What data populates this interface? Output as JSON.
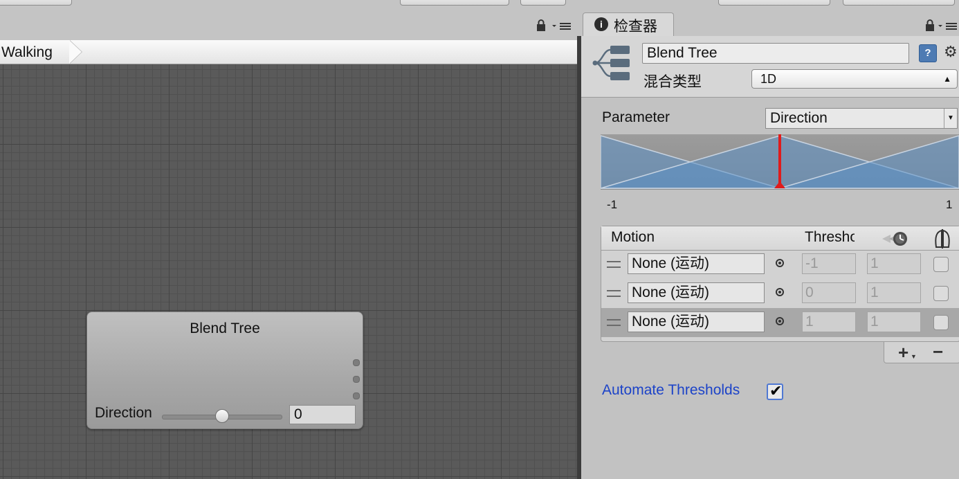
{
  "breadcrumb": {
    "label": "Walking"
  },
  "node": {
    "title": "Blend Tree",
    "param_name": "Direction",
    "param_value": "0",
    "slider_fraction": 0.5
  },
  "inspector": {
    "tab_label": "检查器",
    "tab_icon_glyph": "i",
    "object_name": "Blend Tree",
    "blend_type_label": "混合类型",
    "blend_type_value": "1D",
    "parameter_label": "Parameter",
    "parameter_value": "Direction",
    "graph": {
      "min_label": "-1",
      "max_label": "1",
      "min": -1,
      "max": 1,
      "current": 0,
      "thresholds": [
        -1,
        0,
        1
      ]
    },
    "list": {
      "header_motion": "Motion",
      "header_threshold": "Threshold",
      "rows": [
        {
          "motion": "None (运动)",
          "threshold": "-1",
          "speed": "1",
          "mirror": false,
          "selected": false
        },
        {
          "motion": "None (运动)",
          "threshold": "0",
          "speed": "1",
          "mirror": false,
          "selected": false
        },
        {
          "motion": "None (运动)",
          "threshold": "1",
          "speed": "1",
          "mirror": false,
          "selected": true
        }
      ]
    },
    "add_glyph": "+",
    "remove_glyph": "−",
    "automate_label": "Automate Thresholds",
    "automate_checked": true,
    "help_glyph": "?",
    "gear_glyph": "⚙"
  },
  "colors": {
    "accent": "#1c43c8",
    "graph_fill": "#5b8fc4",
    "indicator": "#e01b1b"
  }
}
